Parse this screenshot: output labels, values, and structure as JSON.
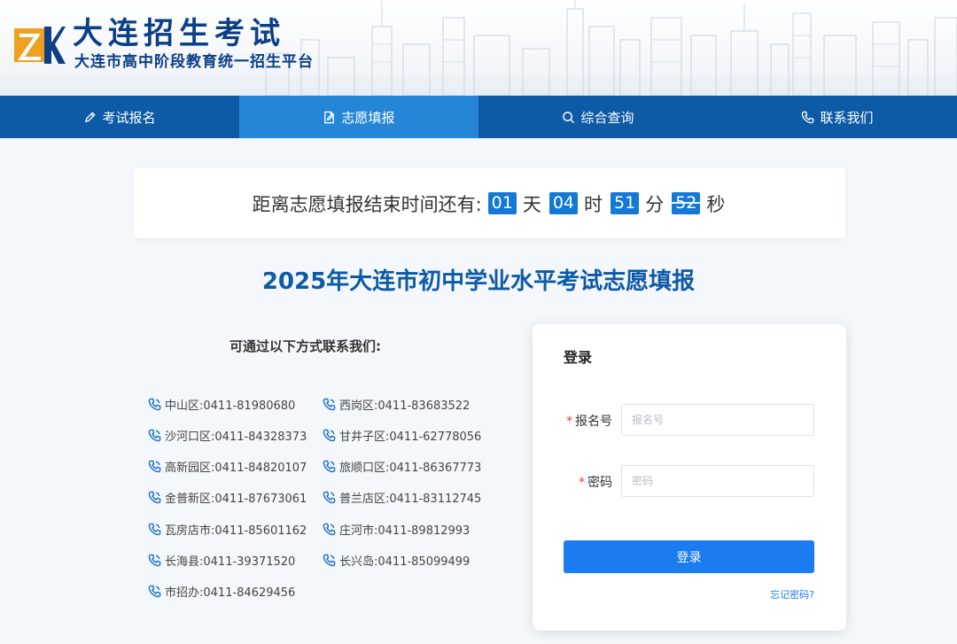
{
  "header": {
    "logo_text": "ZK",
    "title": "大连招生考试",
    "subtitle": "大连市高中阶段教育统一招生平台"
  },
  "nav": {
    "items": [
      {
        "label": "考试报名",
        "icon": "pencil-icon"
      },
      {
        "label": "志愿填报",
        "icon": "edit-document-icon"
      },
      {
        "label": "综合查询",
        "icon": "search-icon"
      },
      {
        "label": "联系我们",
        "icon": "phone-icon"
      }
    ],
    "active_index": 1
  },
  "countdown": {
    "prefix": "距离志愿填报结束时间还有:",
    "days": "01",
    "days_unit": "天",
    "hours": "04",
    "hours_unit": "时",
    "minutes": "51",
    "minutes_unit": "分",
    "seconds": "52",
    "seconds_unit": "秒"
  },
  "main": {
    "title": "2025年大连市初中学业水平考试志愿填报"
  },
  "contacts": {
    "heading": "可通过以下方式联系我们:",
    "items": [
      "中山区:0411-81980680",
      "西岗区:0411-83683522",
      "沙河口区:0411-84328373",
      "甘井子区:0411-62778056",
      "高新园区:0411-84820107",
      "旅顺口区:0411-86367773",
      "金普新区:0411-87673061",
      "普兰店区:0411-83112745",
      "瓦房店市:0411-85601162",
      "庄河市:0411-89812993",
      "长海县:0411-39371520",
      "长兴岛:0411-85099499",
      "市招办:0411-84629456"
    ]
  },
  "login": {
    "title": "登录",
    "username_label": "报名号",
    "username_placeholder": "报名号",
    "password_label": "密码",
    "password_placeholder": "密码",
    "required_mark": "*",
    "submit_label": "登录",
    "forgot_label": "忘记密码?"
  },
  "colors": {
    "nav_bg": "#0d5aa7",
    "nav_active": "#2586d8",
    "accent": "#1a7cf0",
    "title_blue": "#0d5aa7",
    "logo_orange": "#f0a020"
  }
}
